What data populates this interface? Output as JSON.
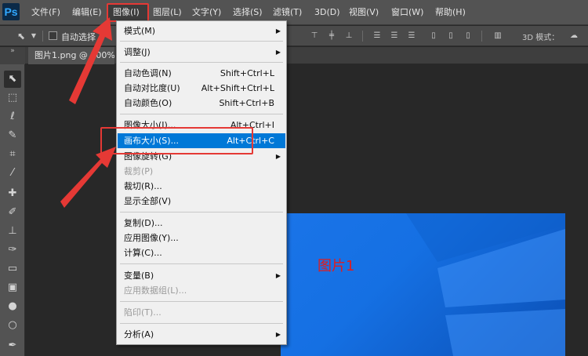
{
  "app": {
    "logo": "Ps"
  },
  "menubar": {
    "items": [
      "文件(F)",
      "编辑(E)",
      "图像(I)",
      "图层(L)",
      "文字(Y)",
      "选择(S)",
      "滤镜(T)",
      "3D(D)",
      "视图(V)",
      "窗口(W)",
      "帮助(H)"
    ]
  },
  "options": {
    "move_tool_icon": "move-arrow-icon",
    "auto_select_label": "自动选择",
    "mode_3d_label": "3D 模式："
  },
  "document": {
    "tab_title": "图片1.png @ 100%",
    "image_label": "图片1"
  },
  "tools": {
    "header_glyph": "»",
    "items": [
      "move",
      "marquee",
      "lasso",
      "quick-selection",
      "crop",
      "eyedropper",
      "healing-brush",
      "brush",
      "clone-stamp",
      "history-brush",
      "eraser",
      "gradient",
      "blur",
      "dodge",
      "pen"
    ]
  },
  "image_menu": {
    "mode": "模式(M)",
    "adjustments": "调整(J)",
    "auto_tone": {
      "label": "自动色调(N)",
      "shortcut": "Shift+Ctrl+L"
    },
    "auto_contrast": {
      "label": "自动对比度(U)",
      "shortcut": "Alt+Shift+Ctrl+L"
    },
    "auto_color": {
      "label": "自动颜色(O)",
      "shortcut": "Shift+Ctrl+B"
    },
    "image_size": {
      "label": "图像大小(I)...",
      "shortcut": "Alt+Ctrl+I"
    },
    "canvas_size": {
      "label": "画布大小(S)...",
      "shortcut": "Alt+Ctrl+C"
    },
    "image_rotation": "图像旋转(G)",
    "crop": "裁剪(P)",
    "trim": "裁切(R)...",
    "reveal_all": "显示全部(V)",
    "duplicate": "复制(D)...",
    "apply_image": "应用图像(Y)...",
    "calculations": "计算(C)...",
    "variables": "变量(B)",
    "apply_data_set": "应用数据组(L)...",
    "trap": "陷印(T)...",
    "analysis": "分析(A)"
  },
  "colors": {
    "highlight": "#0078d7",
    "annotation": "#e53935",
    "image_blue": "#1a74e8"
  }
}
